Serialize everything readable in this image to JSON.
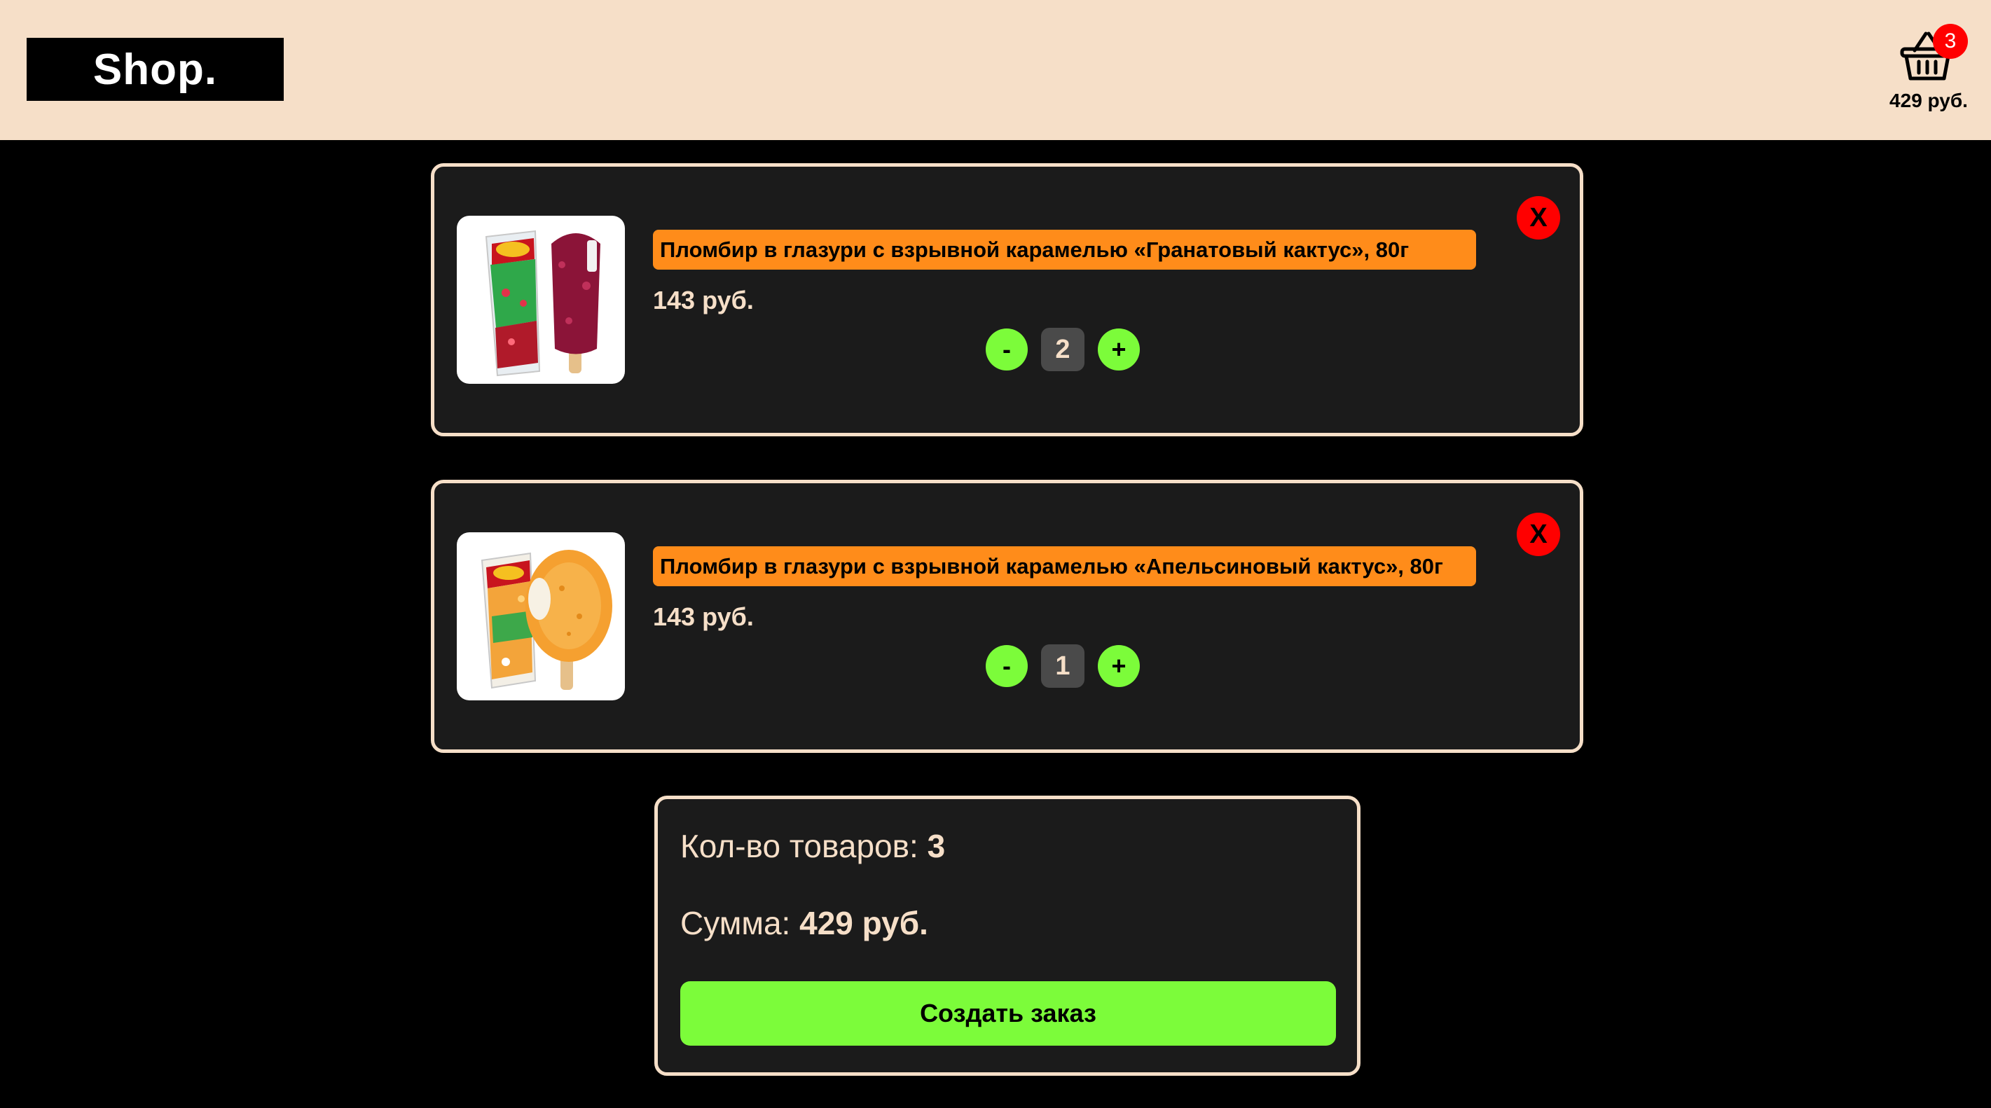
{
  "header": {
    "logo": "Shop.",
    "cart_count": "3",
    "cart_total": "429 руб."
  },
  "items": [
    {
      "title": "Пломбир в глазури с взрывной карамелью «Гранатовый кактус», 80г",
      "price": "143 руб.",
      "quantity": "2",
      "remove_label": "X",
      "minus_label": "-",
      "plus_label": "+",
      "image_icon": "ice-cream-pomegranate-image",
      "accent": "#8b1438"
    },
    {
      "title": "Пломбир в глазури с взрывной карамелью «Апельсиновый кактус», 80г",
      "price": "143 руб.",
      "quantity": "1",
      "remove_label": "X",
      "minus_label": "-",
      "plus_label": "+",
      "image_icon": "ice-cream-orange-image",
      "accent": "#f5a030"
    }
  ],
  "summary": {
    "count_label": "Кол-во товаров: ",
    "count_value": "3",
    "sum_label": "Сумма: ",
    "sum_value": "429 руб.",
    "order_button": "Создать заказ"
  },
  "colors": {
    "header_bg": "#f6dfc8",
    "card_bg": "#1b1b1b",
    "title_bg": "#ff8c1a",
    "button_green": "#7cfc3a",
    "remove_red": "#ff0000"
  }
}
